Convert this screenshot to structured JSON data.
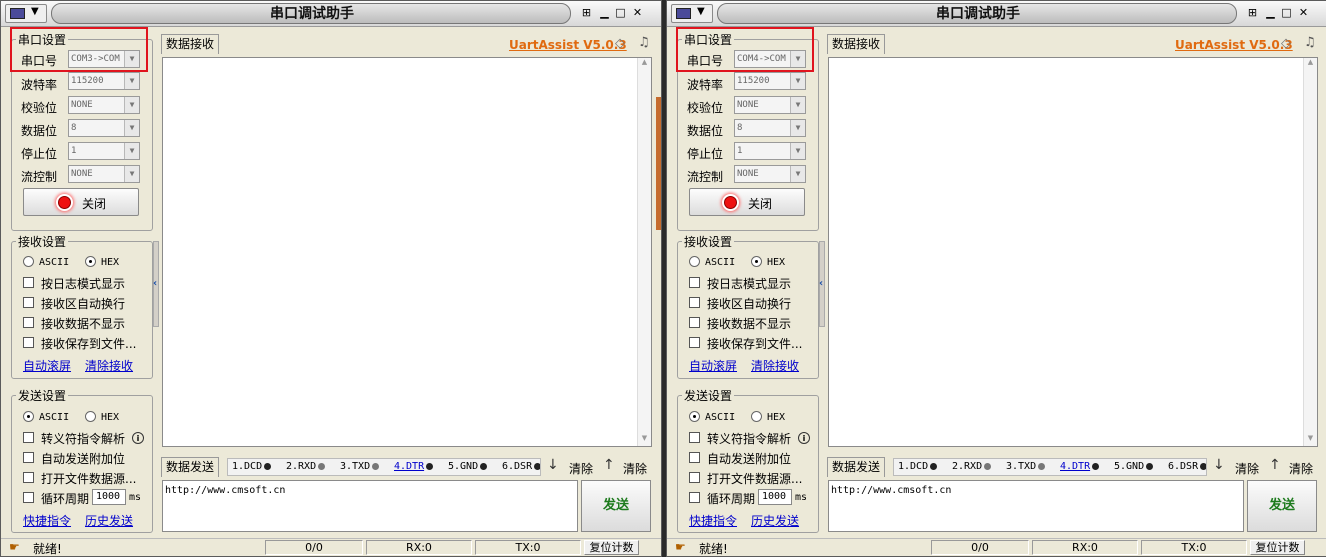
{
  "windows": [
    {
      "title": "串口调试助手",
      "serial": {
        "group_title": "串口设置",
        "port_label": "串口号",
        "port_value": "COM3->COM",
        "baud_label": "波特率",
        "baud_value": "115200",
        "parity_label": "校验位",
        "parity_value": "NONE",
        "databits_label": "数据位",
        "databits_value": "8",
        "stopbits_label": "停止位",
        "stopbits_value": "1",
        "flow_label": "流控制",
        "flow_value": "NONE",
        "toggle_label": "关闭"
      },
      "recv": {
        "group_title": "接收设置",
        "ascii": "ASCII",
        "hex": "HEX",
        "opt_log": "按日志模式显示",
        "opt_wrap": "接收区自动换行",
        "opt_hide": "接收数据不显示",
        "opt_save": "接收保存到文件...",
        "link_autoscroll": "自动滚屏",
        "link_clear": "清除接收"
      },
      "send": {
        "group_title": "发送设置",
        "ascii": "ASCII",
        "hex": "HEX",
        "opt_escape": "转义符指令解析",
        "opt_append": "自动发送附加位",
        "opt_file": "打开文件数据源...",
        "opt_cycle": "循环周期",
        "cycle_value": "1000",
        "cycle_unit": "ms",
        "link_shortcut": "快捷指令",
        "link_history": "历史发送"
      },
      "main": {
        "recv_tab": "数据接收",
        "brand": "UartAssist V5.0.3",
        "send_tab": "数据发送",
        "pins": [
          "1.DCD",
          "2.RXD",
          "3.TXD",
          "4.DTR",
          "5.GND",
          "6.DSR"
        ],
        "clear1": "清除",
        "clear2": "清除",
        "send_text": "http://www.cmsoft.cn",
        "send_button": "发送"
      },
      "status": {
        "ready": "就绪!",
        "count": "0/0",
        "rx": "RX:0",
        "tx": "TX:0",
        "reset": "复位计数"
      }
    },
    {
      "title": "串口调试助手",
      "serial": {
        "group_title": "串口设置",
        "port_label": "串口号",
        "port_value": "COM4->COM",
        "baud_label": "波特率",
        "baud_value": "115200",
        "parity_label": "校验位",
        "parity_value": "NONE",
        "databits_label": "数据位",
        "databits_value": "8",
        "stopbits_label": "停止位",
        "stopbits_value": "1",
        "flow_label": "流控制",
        "flow_value": "NONE",
        "toggle_label": "关闭"
      },
      "recv": {
        "group_title": "接收设置",
        "ascii": "ASCII",
        "hex": "HEX",
        "opt_log": "按日志模式显示",
        "opt_wrap": "接收区自动换行",
        "opt_hide": "接收数据不显示",
        "opt_save": "接收保存到文件...",
        "link_autoscroll": "自动滚屏",
        "link_clear": "清除接收"
      },
      "send": {
        "group_title": "发送设置",
        "ascii": "ASCII",
        "hex": "HEX",
        "opt_escape": "转义符指令解析",
        "opt_append": "自动发送附加位",
        "opt_file": "打开文件数据源...",
        "opt_cycle": "循环周期",
        "cycle_value": "1000",
        "cycle_unit": "ms",
        "link_shortcut": "快捷指令",
        "link_history": "历史发送"
      },
      "main": {
        "recv_tab": "数据接收",
        "brand": "UartAssist V5.0.3",
        "send_tab": "数据发送",
        "pins": [
          "1.DCD",
          "2.RXD",
          "3.TXD",
          "4.DTR",
          "5.GND",
          "6.DSR"
        ],
        "clear1": "清除",
        "clear2": "清除",
        "send_text": "http://www.cmsoft.cn",
        "send_button": "发送"
      },
      "status": {
        "ready": "就绪!",
        "count": "0/0",
        "rx": "RX:0",
        "tx": "TX:0",
        "reset": "复位计数"
      }
    }
  ],
  "colors": {
    "highlight_box": "#e0141e",
    "brand": "#e06a10",
    "link": "#0000cc",
    "send_button_text": "#1c7a1c"
  }
}
